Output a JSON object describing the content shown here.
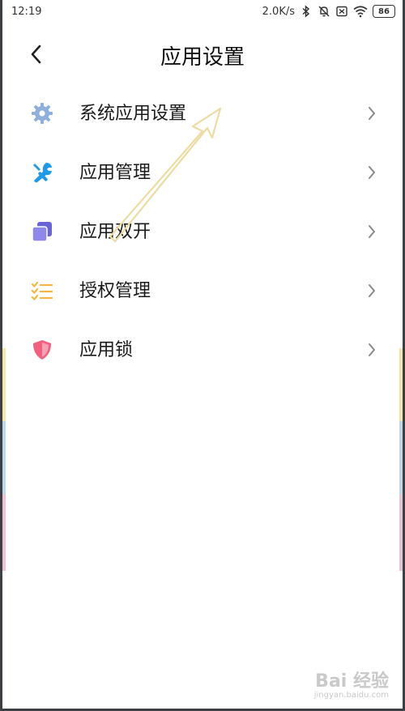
{
  "status_bar": {
    "time": "12:19",
    "net_speed": "2.0K/s",
    "battery": "86",
    "icons": [
      "bluetooth-icon",
      "mute-icon",
      "sim-disabled-icon",
      "wifi-icon",
      "battery-icon"
    ]
  },
  "header": {
    "title": "应用设置",
    "back_icon": "chevron-left-icon"
  },
  "menu": {
    "items": [
      {
        "label": "系统应用设置",
        "icon": "gear-icon",
        "color": "#8fb0dc"
      },
      {
        "label": "应用管理",
        "icon": "tools-icon",
        "color": "#1e9be8"
      },
      {
        "label": "应用双开",
        "icon": "dual-app-icon",
        "color": "#6b63d9"
      },
      {
        "label": "授权管理",
        "icon": "checklist-icon",
        "color": "#f4b63f"
      },
      {
        "label": "应用锁",
        "icon": "shield-icon",
        "color": "#f2607f"
      }
    ]
  },
  "watermark": {
    "main": "Bai 经验",
    "sub": "jingyan.baidu.com"
  },
  "colors": {
    "annotation_arrow": "#ecdca2",
    "chevron": "#8a8a8a",
    "frame": "#3c3f44"
  }
}
